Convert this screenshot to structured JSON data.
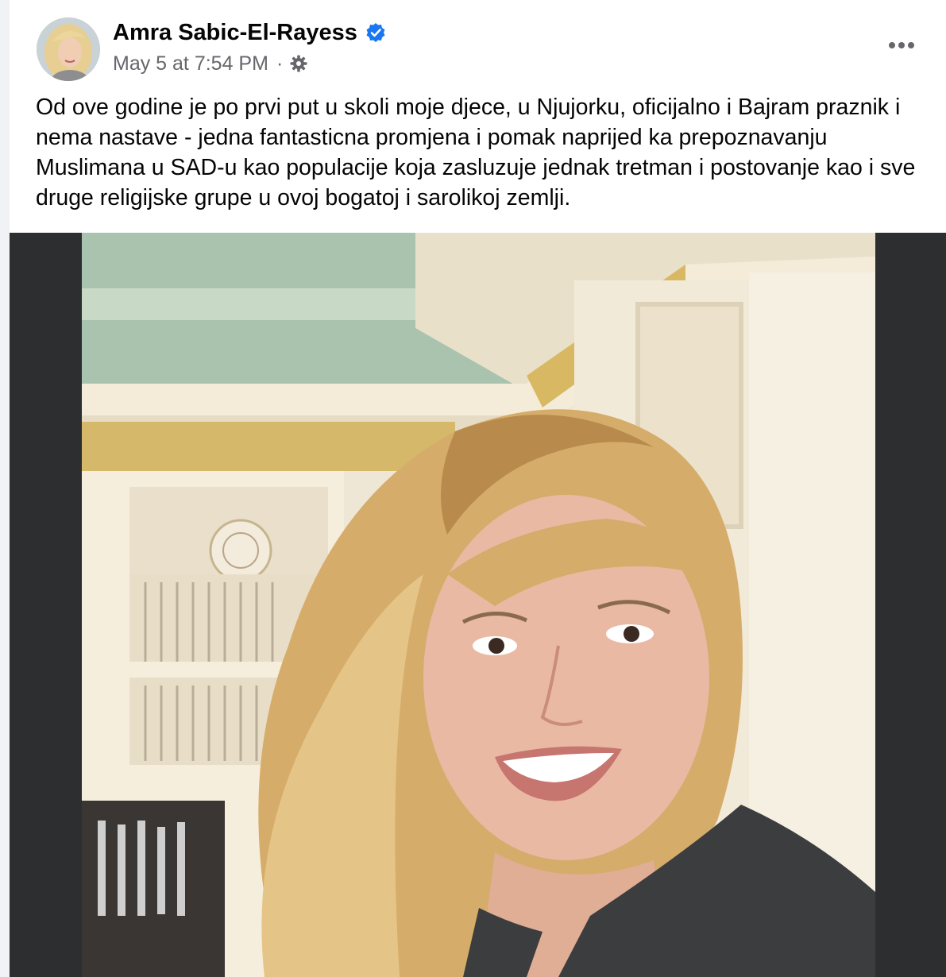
{
  "post": {
    "author": "Amra Sabic-El-Rayess",
    "verified": true,
    "timestamp": "May 5 at 7:54 PM",
    "separator": "·",
    "privacy_icon": "gear-icon",
    "text": "Od ove godine je po prvi put u skoli moje djece, u Njujorku, oficijalno i Bajram praznik i nema nastave - jedna fantasticna promjena i pomak naprijed ka prepoznavanju Muslimana u SAD-u kao populacije koja zasluzuje jednak tretman i postovanje kao i sve druge religijske grupe u ovoj bogatoj i sarolikoj zemlji."
  },
  "icons": {
    "verified": "verified-badge-icon",
    "more": "more-options-icon"
  },
  "colors": {
    "verified_blue": "#1877f2",
    "meta_gray": "#65676b",
    "media_bg": "#2d2e2f"
  }
}
